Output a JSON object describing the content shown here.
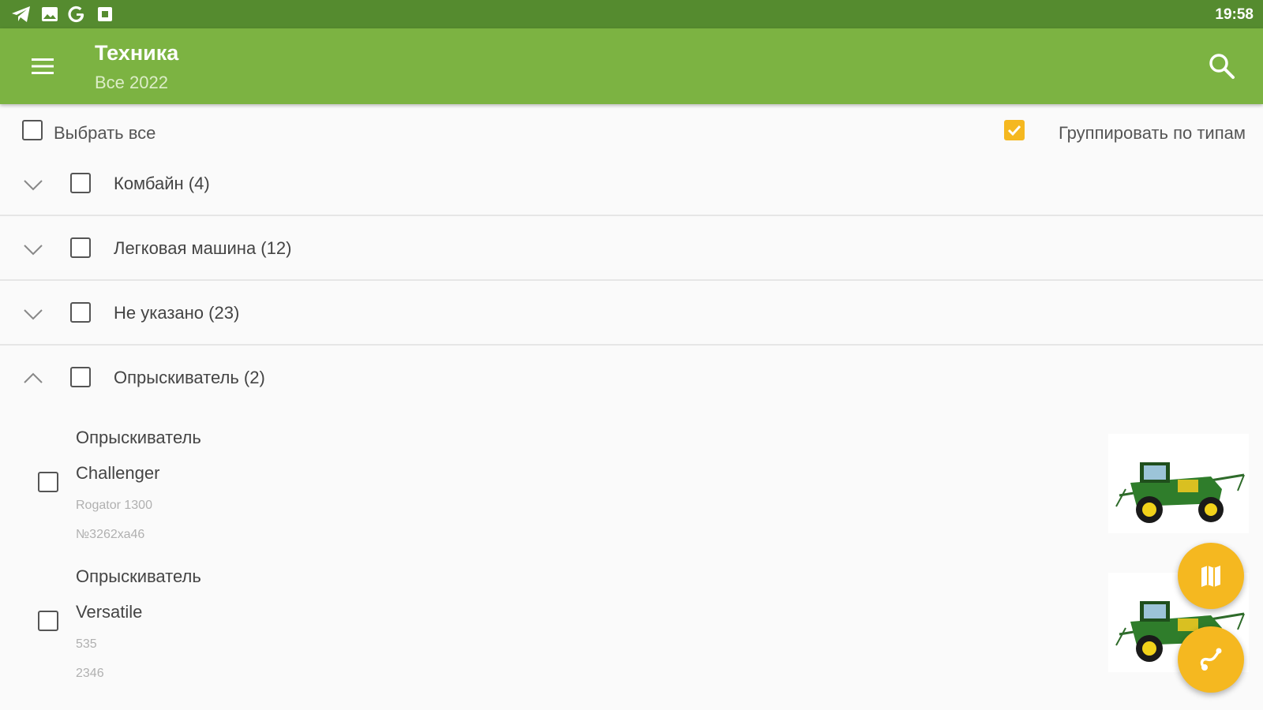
{
  "status_bar": {
    "time": "19:58",
    "icons": [
      "telegram-icon",
      "image-icon",
      "google-icon",
      "app-icon"
    ],
    "color": "#558b2f"
  },
  "app_bar": {
    "title": "Техника",
    "subtitle": "Все 2022",
    "color": "#7cb342",
    "menu_icon": "hamburger-menu-icon",
    "search_icon": "search-icon"
  },
  "toolbar": {
    "select_all_label": "Выбрать все",
    "select_all_checked": false,
    "group_by_type_label": "Группировать по типам",
    "group_by_type_checked": true
  },
  "groups": [
    {
      "label": "Комбайн (4)",
      "expanded": false,
      "checked": false
    },
    {
      "label": "Легковая машина (12)",
      "expanded": false,
      "checked": false
    },
    {
      "label": "Не указано (23)",
      "expanded": false,
      "checked": false
    },
    {
      "label": "Опрыскиватель (2)",
      "expanded": true,
      "checked": false
    }
  ],
  "items": [
    {
      "type": "Опрыскиватель",
      "name": "Challenger",
      "model": "Rogator 1300",
      "number": "№3262ха46",
      "checked": false
    },
    {
      "type": "Опрыскиватель",
      "name": "Versatile",
      "model": "535",
      "number": "2346",
      "checked": false
    }
  ],
  "fabs": [
    {
      "icon": "map-icon"
    },
    {
      "icon": "route-icon"
    }
  ],
  "accent_color": "#f5b820"
}
